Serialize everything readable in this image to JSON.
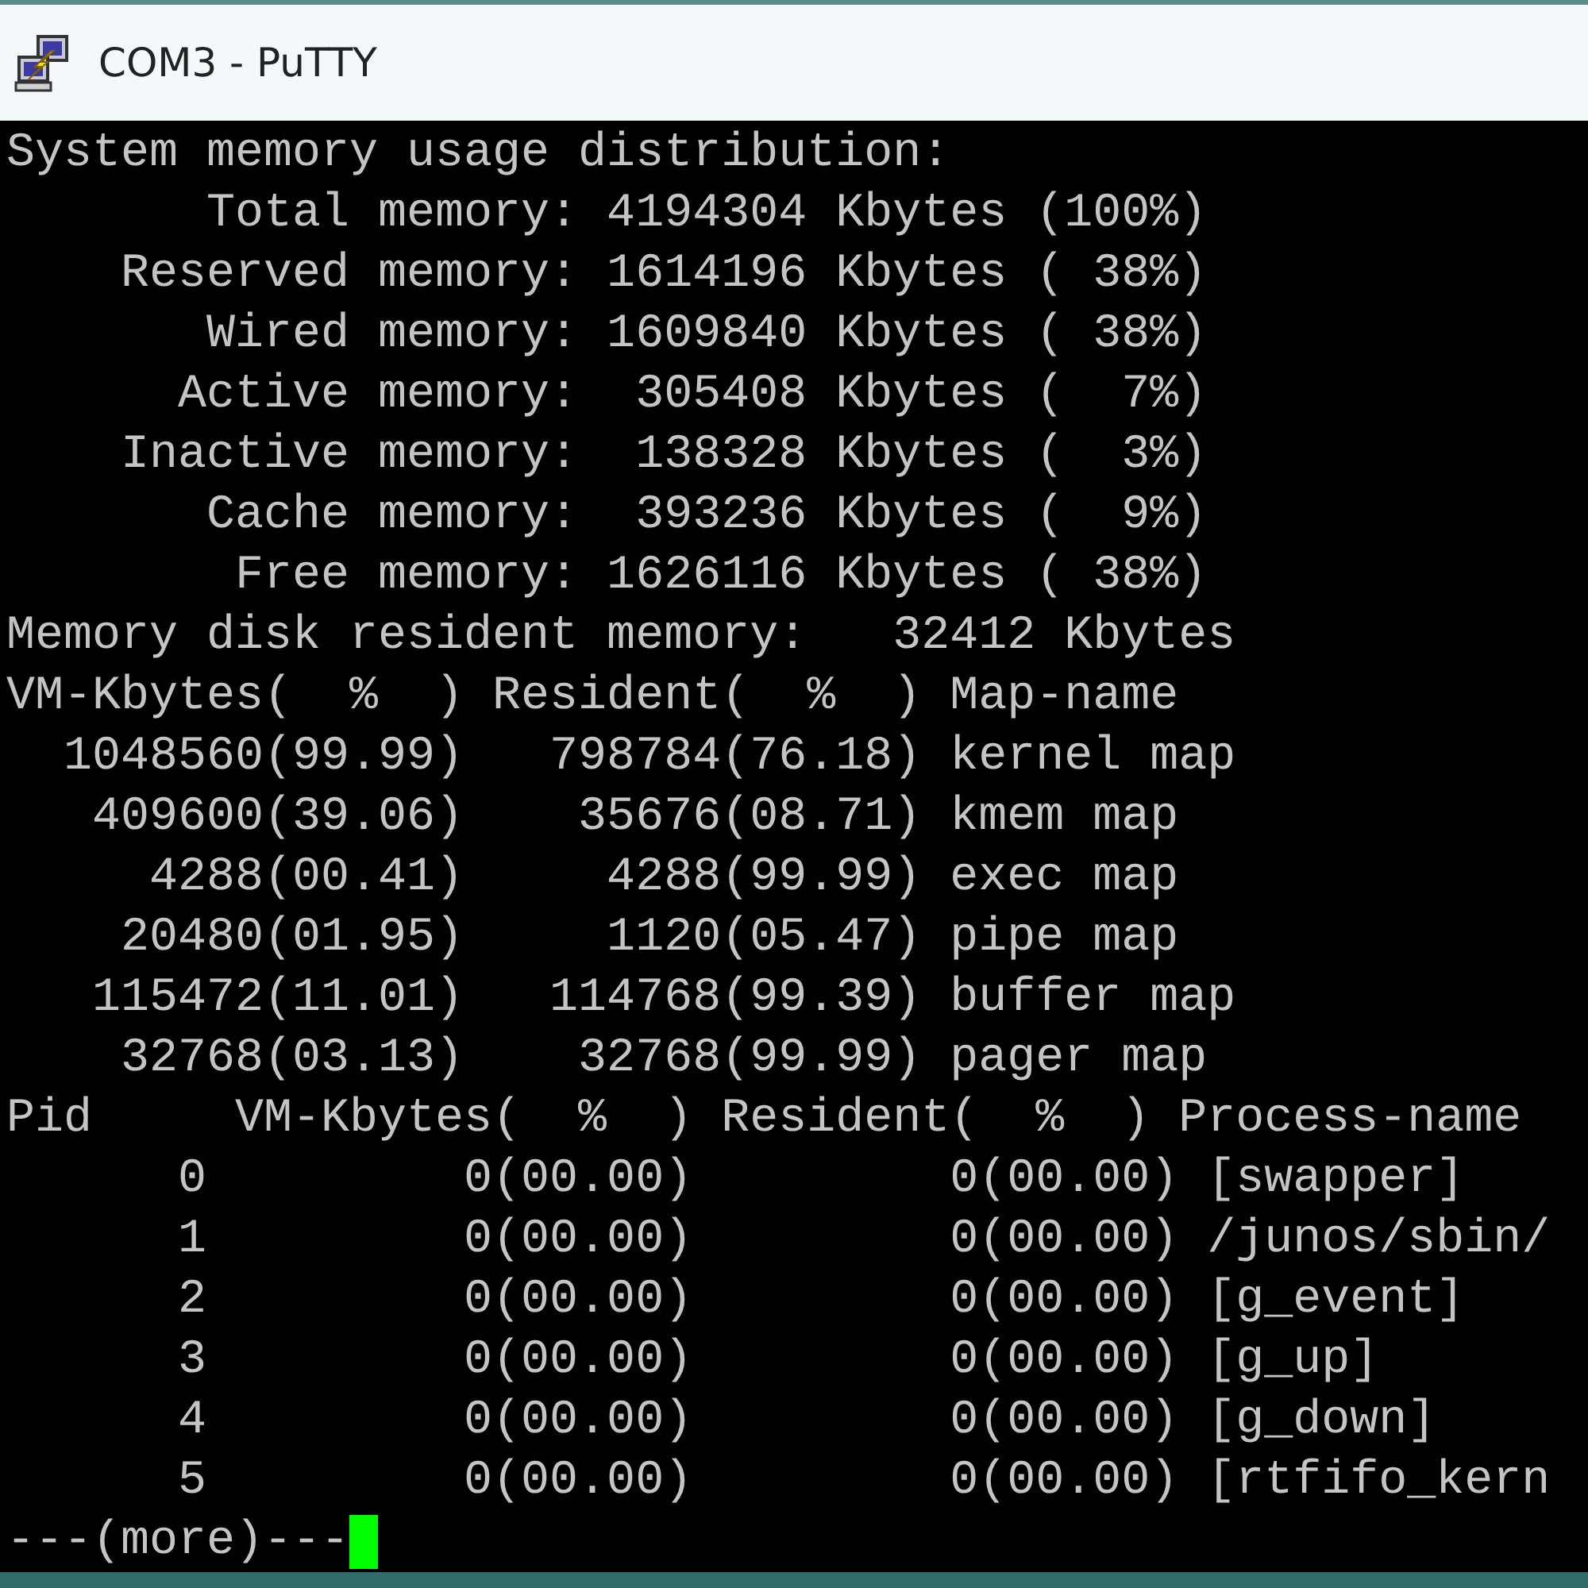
{
  "window": {
    "title": "COM3 - PuTTY"
  },
  "terminal": {
    "lines": [
      "System memory usage distribution:",
      "       Total memory: 4194304 Kbytes (100%)",
      "    Reserved memory: 1614196 Kbytes ( 38%)",
      "       Wired memory: 1609840 Kbytes ( 38%)",
      "      Active memory:  305408 Kbytes (  7%)",
      "    Inactive memory:  138328 Kbytes (  3%)",
      "       Cache memory:  393236 Kbytes (  9%)",
      "        Free memory: 1626116 Kbytes ( 38%)",
      "Memory disk resident memory:   32412 Kbytes",
      "VM-Kbytes(  %  ) Resident(  %  ) Map-name",
      "  1048560(99.99)   798784(76.18) kernel map",
      "   409600(39.06)    35676(08.71) kmem map",
      "     4288(00.41)     4288(99.99) exec map",
      "    20480(01.95)     1120(05.47) pipe map",
      "   115472(11.01)   114768(99.39) buffer map",
      "    32768(03.13)    32768(99.99) pager map",
      "Pid     VM-Kbytes(  %  ) Resident(  %  ) Process-name",
      "      0         0(00.00)         0(00.00) [swapper]",
      "      1         0(00.00)         0(00.00) /junos/sbin/",
      "      2         0(00.00)         0(00.00) [g_event]",
      "      3         0(00.00)         0(00.00) [g_up]",
      "      4         0(00.00)         0(00.00) [g_down]",
      "      5         0(00.00)         0(00.00) [rtfifo_kern"
    ],
    "pager_prompt": "---(more)---"
  }
}
